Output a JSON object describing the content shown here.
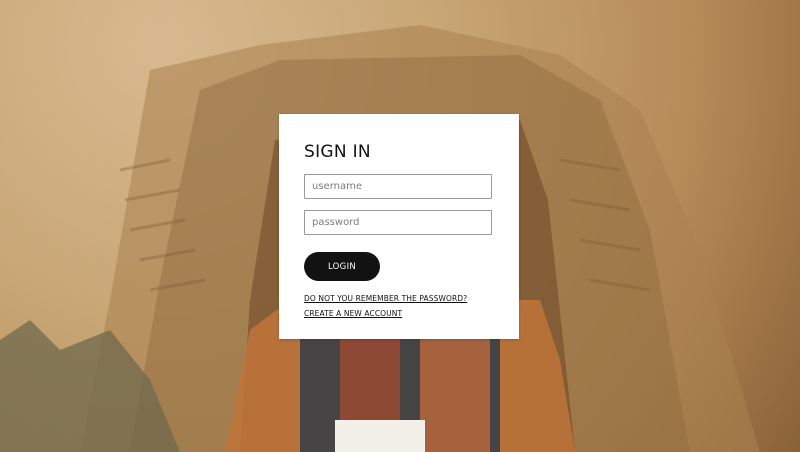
{
  "signin": {
    "title": "SIGN IN",
    "username_placeholder": "username",
    "password_placeholder": "password",
    "login_label": "LOGIN",
    "forgot_link": "DO NOT YOU REMEMBER THE PASSWORD?",
    "create_link": "CREATE A NEW ACCOUNT"
  },
  "colors": {
    "button": "#121212",
    "card": "#ffffff",
    "background_sand": "#c9a777"
  }
}
